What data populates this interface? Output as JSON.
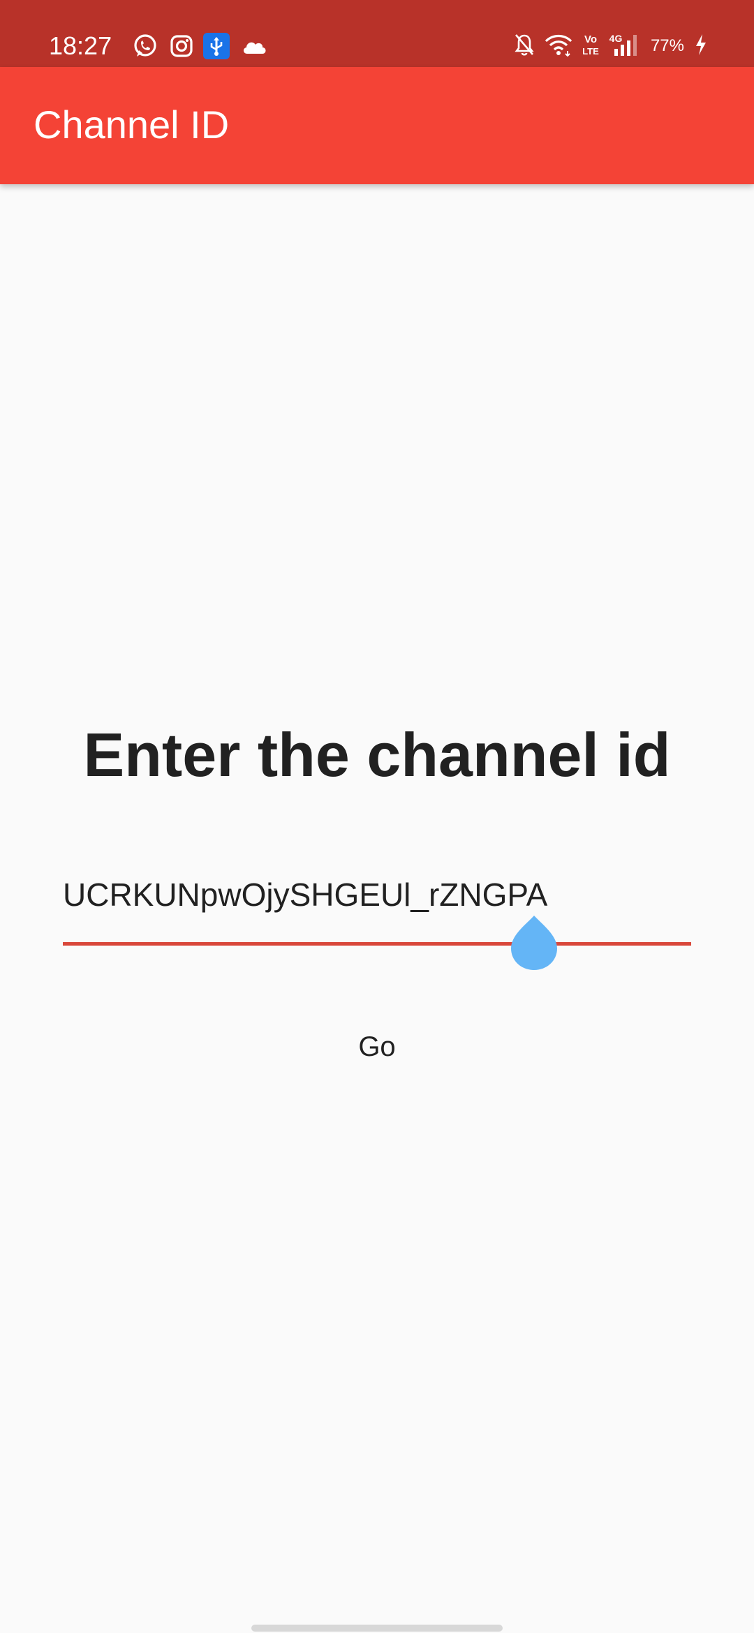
{
  "status_bar": {
    "time": "18:27",
    "battery": "77%",
    "left_icons": [
      "whatsapp-icon",
      "instagram-icon",
      "usb-debug-icon",
      "cloud-icon"
    ],
    "right_icons": [
      "notifications-off-icon",
      "wifi-icon",
      "volte-icon",
      "signal-4g-icon",
      "charging-icon"
    ],
    "color": "#b83229"
  },
  "app_bar": {
    "title": "Channel ID",
    "color": "#f44336"
  },
  "main": {
    "heading": "Enter the channel id",
    "channel_input_value": "UCRKUNpwOjySHGEUl_rZNGPA",
    "underline_color": "#d9473a",
    "cursor_handle_color": "#64b5f6",
    "go_label": "Go"
  }
}
